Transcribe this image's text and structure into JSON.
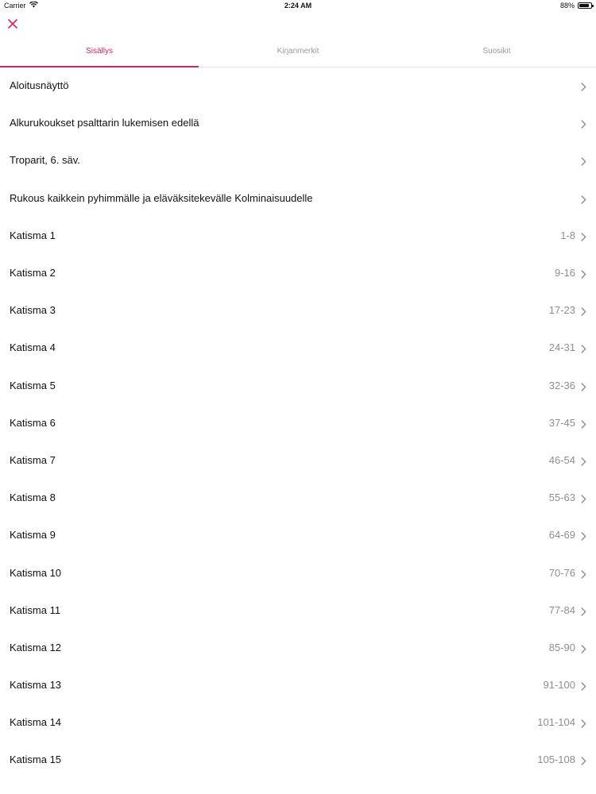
{
  "status_bar": {
    "carrier": "Carrier",
    "time": "2:24 AM",
    "battery": "88%",
    "battery_level": 0.88
  },
  "close_icon": "close-icon",
  "accent_color": "#d6245a",
  "tabs": [
    {
      "label": "Sisällys",
      "active": true
    },
    {
      "label": "Kirjanmerkit",
      "active": false
    },
    {
      "label": "Suosikit",
      "active": false
    }
  ],
  "items": [
    {
      "label": "Aloitusnäyttö",
      "detail": ""
    },
    {
      "label": "Alkurukoukset psalttarin lukemisen edellä",
      "detail": ""
    },
    {
      "label": "Troparit, 6. säv.",
      "detail": ""
    },
    {
      "label": "Rukous kaikkein pyhimmälle ja eläväksitekevälle Kolminaisuudelle",
      "detail": ""
    },
    {
      "label": "Katisma 1",
      "detail": "1-8"
    },
    {
      "label": "Katisma 2",
      "detail": "9-16"
    },
    {
      "label": "Katisma 3",
      "detail": "17-23"
    },
    {
      "label": "Katisma 4",
      "detail": "24-31"
    },
    {
      "label": "Katisma 5",
      "detail": "32-36"
    },
    {
      "label": "Katisma 6",
      "detail": "37-45"
    },
    {
      "label": "Katisma 7",
      "detail": "46-54"
    },
    {
      "label": "Katisma 8",
      "detail": "55-63"
    },
    {
      "label": "Katisma 9",
      "detail": "64-69"
    },
    {
      "label": "Katisma 10",
      "detail": "70-76"
    },
    {
      "label": "Katisma 11",
      "detail": "77-84"
    },
    {
      "label": "Katisma 12",
      "detail": "85-90"
    },
    {
      "label": "Katisma 13",
      "detail": "91-100"
    },
    {
      "label": "Katisma 14",
      "detail": "101-104"
    },
    {
      "label": "Katisma 15",
      "detail": "105-108"
    }
  ]
}
